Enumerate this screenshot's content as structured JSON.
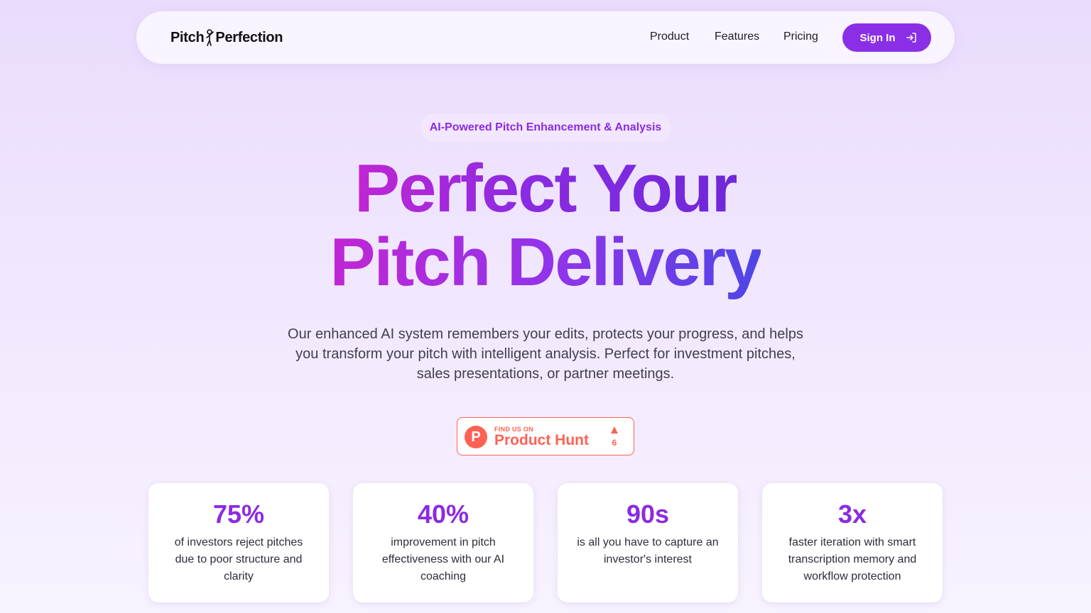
{
  "nav": {
    "logo_left": "Pitch",
    "logo_right": "Perfection",
    "links": [
      "Product",
      "Features",
      "Pricing"
    ],
    "signin_label": "Sign In"
  },
  "hero": {
    "badge": "AI-Powered Pitch Enhancement & Analysis",
    "headline_line1": "Perfect Your",
    "headline_line2": "Pitch Delivery",
    "subtext": "Our enhanced AI system remembers your edits, protects your progress, and helps you transform your pitch with intelligent analysis. Perfect for investment pitches, sales presentations, or partner meetings."
  },
  "product_hunt": {
    "logo_letter": "P",
    "small_text": "FIND US ON",
    "big_text": "Product Hunt",
    "upvotes": "6",
    "color": "#ff6154",
    "icon": "upvote-triangle-icon"
  },
  "stats": [
    {
      "value": "75%",
      "desc": "of investors reject pitches due to poor structure and clarity"
    },
    {
      "value": "40%",
      "desc": "improvement in pitch effectiveness with our AI coaching"
    },
    {
      "value": "90s",
      "desc": "is all you have to capture an investor's interest"
    },
    {
      "value": "3x",
      "desc": "faster iteration with smart transcription memory and workflow protection"
    }
  ],
  "colors": {
    "accent": "#8b2fe6",
    "gradient_start": "#c026d3",
    "gradient_end": "#4f46e5"
  }
}
